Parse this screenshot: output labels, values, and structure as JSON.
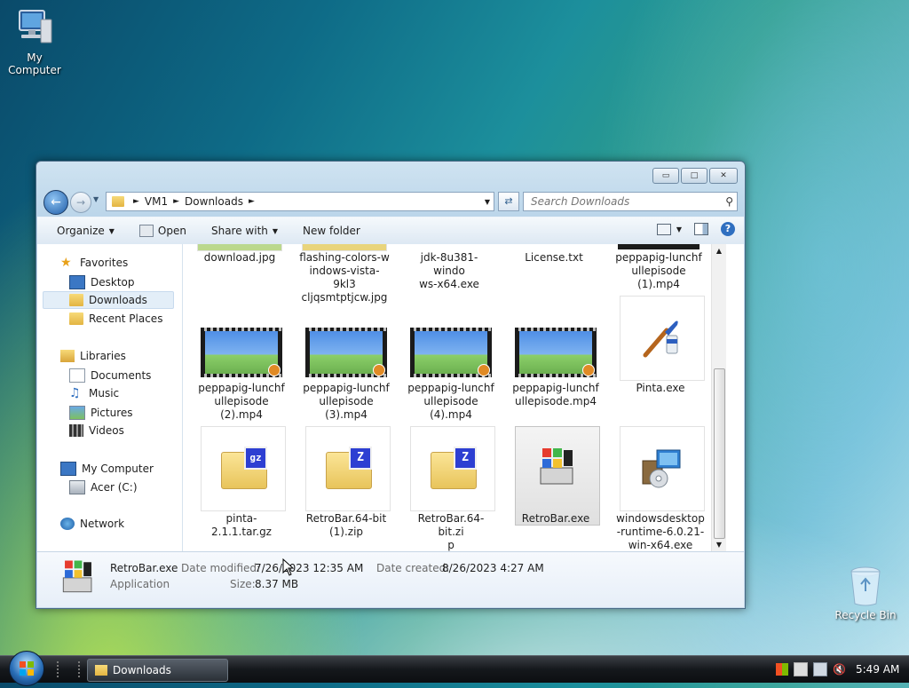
{
  "desktop": {
    "icons": [
      {
        "label": "My Computer"
      },
      {
        "label": "Recycle Bin"
      }
    ]
  },
  "window": {
    "caption_buttons": {
      "minimize": "▭",
      "maximize": "□",
      "close": "✕"
    },
    "address": {
      "segments": [
        "VM1",
        "Downloads"
      ]
    },
    "search": {
      "placeholder": "Search Downloads"
    },
    "toolbar": {
      "organize": "Organize",
      "open": "Open",
      "share_with": "Share with",
      "new_folder": "New folder"
    },
    "nav": {
      "favorites": "Favorites",
      "desktop": "Desktop",
      "downloads": "Downloads",
      "recent_places": "Recent Places",
      "libraries": "Libraries",
      "documents": "Documents",
      "music": "Music",
      "pictures": "Pictures",
      "videos": "Videos",
      "my_computer": "My Computer",
      "acer": "Acer (C:)",
      "network": "Network"
    },
    "files": [
      {
        "name": "download.jpg"
      },
      {
        "name": "flashing-colors-windows-vista-9kl3cljqsmtptjcw.jpg"
      },
      {
        "name": "jdk-8u381-windows-x64.exe"
      },
      {
        "name": "License.txt"
      },
      {
        "name": "peppapig-lunchfullepisode (1).mp4"
      },
      {
        "name": "peppapig-lunchfullepisode (2).mp4"
      },
      {
        "name": "peppapig-lunchfullepisode (3).mp4"
      },
      {
        "name": "peppapig-lunchfullepisode (4).mp4"
      },
      {
        "name": "peppapig-lunchfullepisode.mp4"
      },
      {
        "name": "Pinta.exe"
      },
      {
        "name": "pinta-2.1.1.tar.gz"
      },
      {
        "name": "RetroBar.64-bit (1).zip"
      },
      {
        "name": "RetroBar.64-bit.zip"
      },
      {
        "name": "RetroBar.exe"
      },
      {
        "name": "windowsdesktop-runtime-6.0.21-win-x64.exe"
      }
    ],
    "file_lines": {
      "f1": [
        "flashing-colors-w",
        "indows-vista-9kl3",
        "cljqsmtptjcw.jpg"
      ],
      "f2": [
        "jdk-8u381-windo",
        "ws-x64.exe"
      ],
      "f4": [
        "peppapig-lunchf",
        "ullepisode",
        "(1).mp4"
      ],
      "f5": [
        "peppapig-lunchf",
        "ullepisode",
        "(2).mp4"
      ],
      "f6": [
        "peppapig-lunchf",
        "ullepisode",
        "(3).mp4"
      ],
      "f7": [
        "peppapig-lunchf",
        "ullepisode",
        "(4).mp4"
      ],
      "f8": [
        "peppapig-lunchf",
        "ullepisode.mp4"
      ],
      "f11": [
        "RetroBar.64-bit",
        "(1).zip"
      ],
      "f12": [
        "RetroBar.64-bit.zi",
        "p"
      ],
      "f14": [
        "windowsdesktop",
        "-runtime-6.0.21-",
        "win-x64.exe"
      ]
    },
    "zip_badges": {
      "gz": "gz",
      "z": "Z"
    },
    "details": {
      "name": "RetroBar.exe",
      "type": "Application",
      "modified_label": "Date modified:",
      "modified": "7/26/2023 12:35 AM",
      "created_label": "Date created:",
      "created": "8/26/2023 4:27 AM",
      "size_label": "Size:",
      "size": "8.37 MB"
    }
  },
  "taskbar": {
    "window_button": "Downloads",
    "clock": "5:49 AM"
  }
}
